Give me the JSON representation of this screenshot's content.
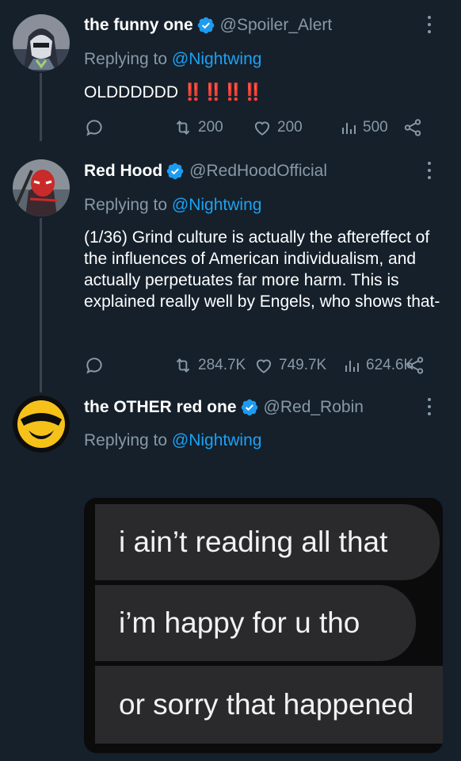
{
  "tweets": [
    {
      "display_name": "the funny one",
      "handle": "@Spoiler_Alert",
      "replying_prefix": "Replying to",
      "replying_to": "@Nightwing",
      "text": "OLDDDDDD",
      "emphasis": "‼️‼️‼️‼️",
      "retweets": "200",
      "likes": "200",
      "views": "500"
    },
    {
      "display_name": "Red Hood",
      "handle": "@RedHoodOfficial",
      "replying_prefix": "Replying to",
      "replying_to": "@Nightwing",
      "text": "(1/36) Grind culture is actually the aftereffect of the influences of American individualism, and actually perpetuates far more harm. This is explained really well by Engels, who shows that-",
      "retweets": "284.7K",
      "likes": "749.7K",
      "views": "624.6K"
    },
    {
      "display_name": "the OTHER red one",
      "handle": "@Red_Robin",
      "replying_prefix": "Replying to",
      "replying_to": "@Nightwing",
      "meme_lines": [
        "i ain’t reading all that",
        "i’m happy for u tho",
        "or sorry that happened"
      ]
    }
  ],
  "colors": {
    "background": "#15202b",
    "secondary_text": "#8899a6",
    "link": "#1da1f2",
    "verified": "#1d9bf0",
    "thread_line": "#38444d"
  },
  "icons": [
    "reply-icon",
    "retweet-icon",
    "like-icon",
    "views-icon",
    "share-icon",
    "verified-badge-icon",
    "more-options-icon"
  ]
}
